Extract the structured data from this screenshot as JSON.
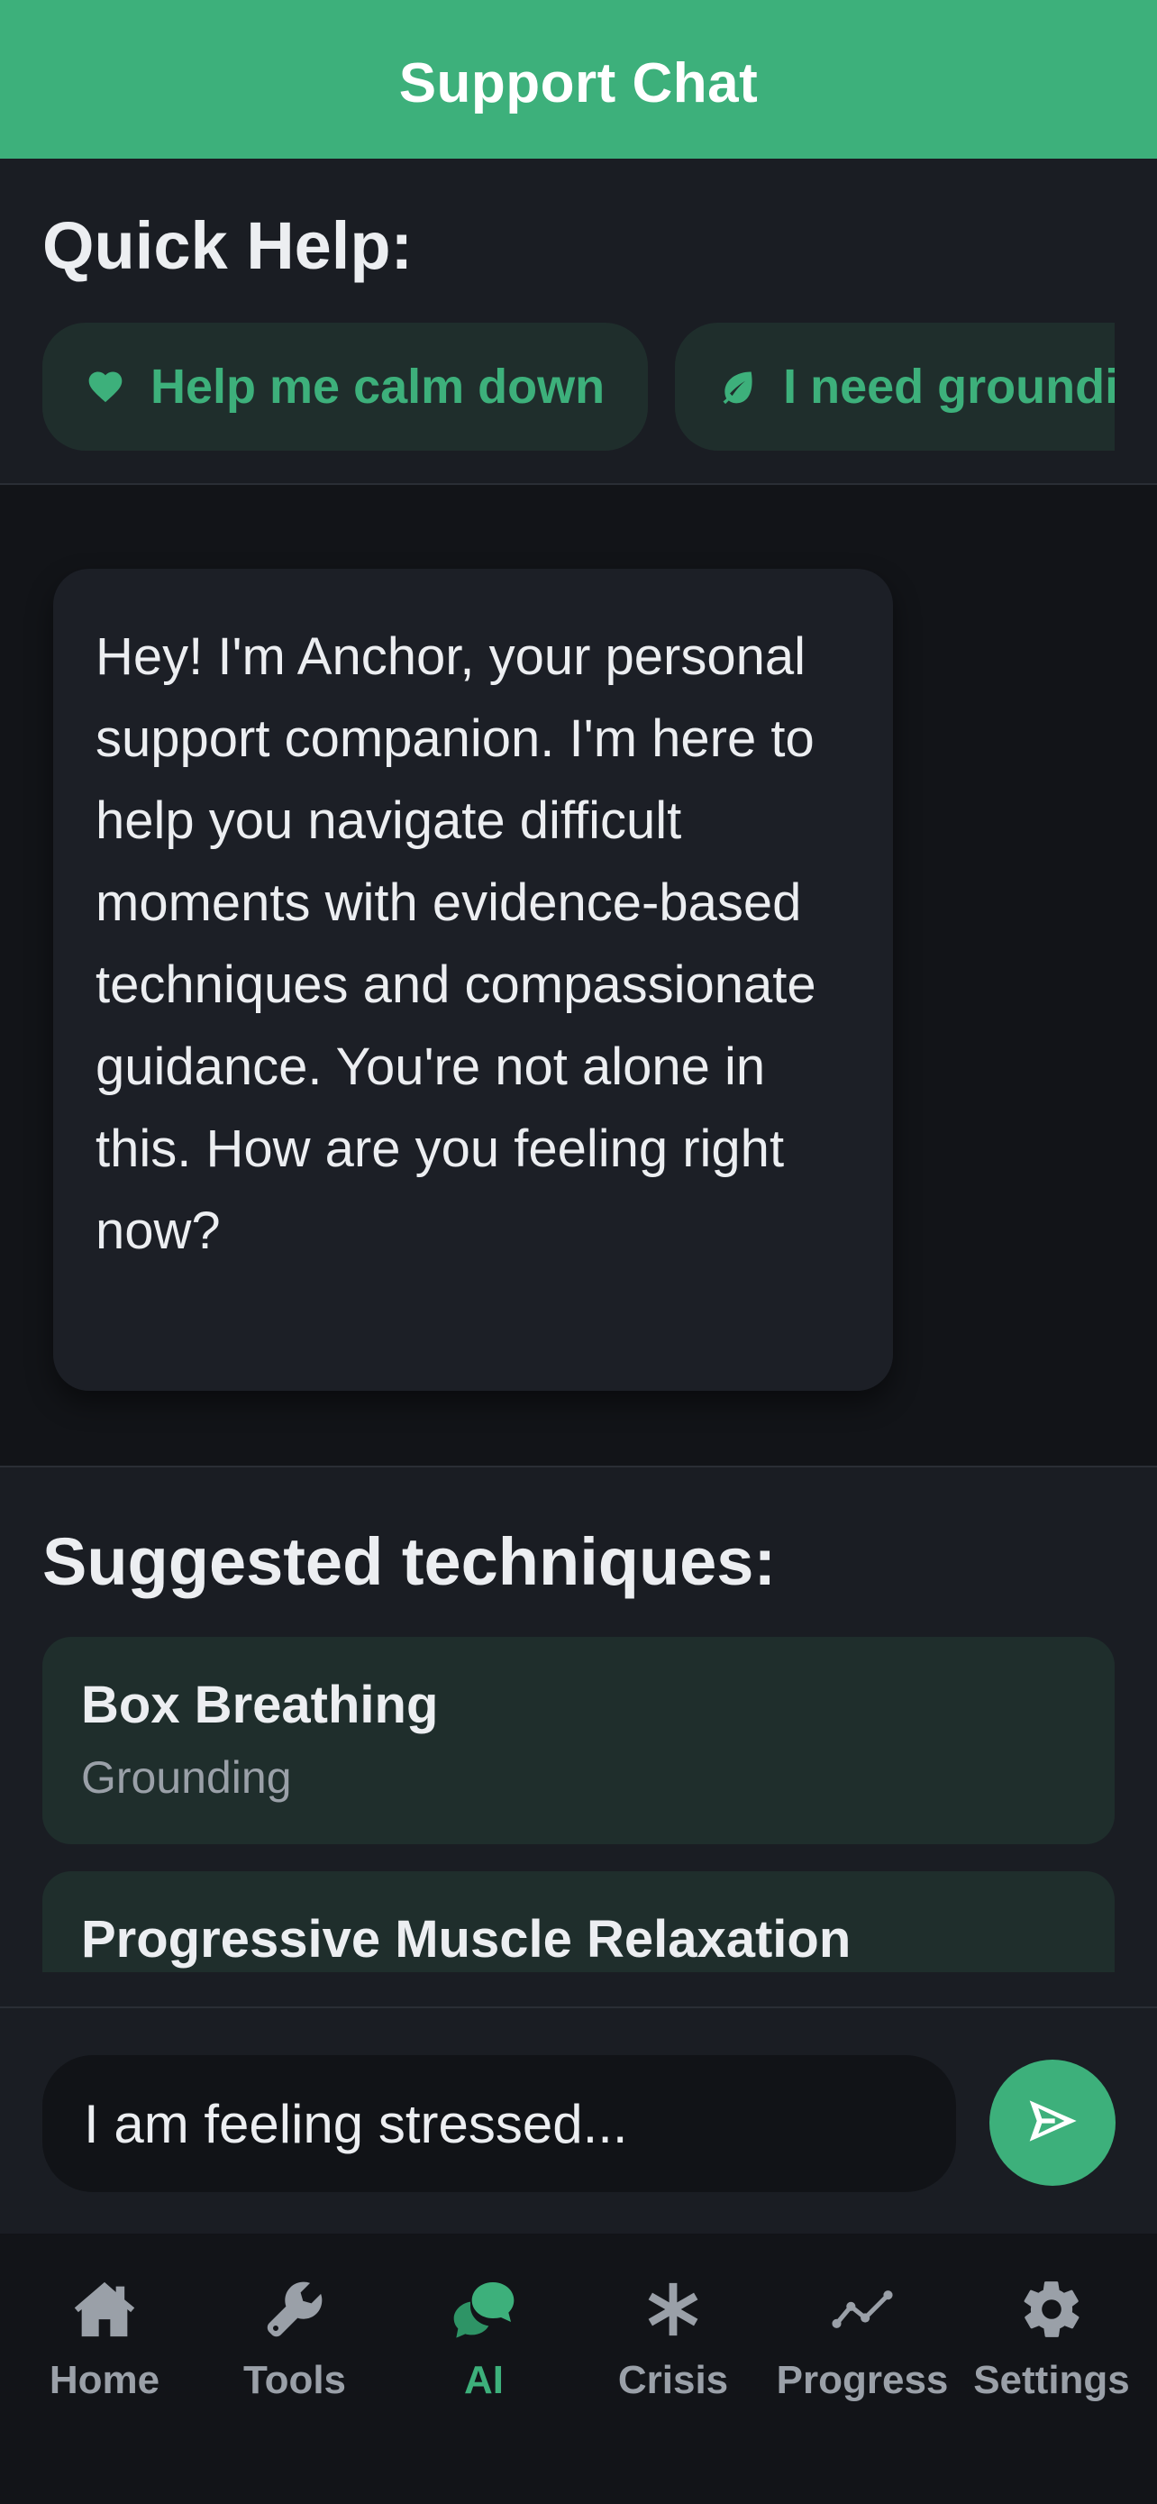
{
  "header": {
    "title": "Support Chat"
  },
  "quick_help": {
    "title": "Quick Help:",
    "chips": [
      {
        "label": "Help me calm down",
        "icon": "heart-icon"
      },
      {
        "label": "I need grounding",
        "icon": "leaf-icon"
      }
    ]
  },
  "chat": {
    "messages": [
      {
        "sender": "assistant",
        "text": "Hey! I'm Anchor, your personal support companion. I'm here to help you navigate difficult moments with evidence-based techniques and compassionate guidance. You're not alone in this. How are you feeling right now?"
      }
    ]
  },
  "suggestions": {
    "title": "Suggested techniques:",
    "items": [
      {
        "name": "Box Breathing",
        "category": "Grounding"
      },
      {
        "name": "Progressive Muscle Relaxation",
        "category": ""
      }
    ]
  },
  "composer": {
    "value": "I am feeling stressed...",
    "send_icon": "send-icon"
  },
  "nav": {
    "items": [
      {
        "label": "Home",
        "icon": "home-icon"
      },
      {
        "label": "Tools",
        "icon": "wrench-icon"
      },
      {
        "label": "AI",
        "icon": "chat-bubbles-icon",
        "active": true
      },
      {
        "label": "Crisis",
        "icon": "asterisk-icon"
      },
      {
        "label": "Progress",
        "icon": "line-chart-icon"
      },
      {
        "label": "Settings",
        "icon": "gear-icon"
      }
    ]
  },
  "colors": {
    "accent": "#3DB07B",
    "background": "#111317",
    "surface": "#1A1D23",
    "card": "#1F2E2C",
    "muted_text": "#9AA0A8"
  }
}
